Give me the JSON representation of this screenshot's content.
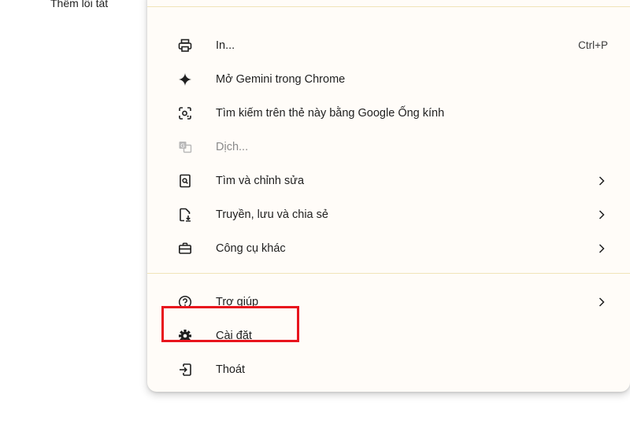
{
  "background": {
    "label": "Thêm lối tắt"
  },
  "menu": {
    "items": [
      {
        "icon": "print-icon",
        "label": "In...",
        "shortcut": "Ctrl+P"
      },
      {
        "icon": "gemini-sparkle-icon",
        "label": "Mở Gemini trong Chrome"
      },
      {
        "icon": "google-lens-icon",
        "label": "Tìm kiếm trên thẻ này bằng Google Ống kính"
      },
      {
        "icon": "translate-icon",
        "label": "Dịch...",
        "disabled": true
      },
      {
        "icon": "find-edit-icon",
        "label": "Tìm và chỉnh sửa",
        "submenu": true
      },
      {
        "icon": "cast-save-share-icon",
        "label": "Truyền, lưu và chia sẻ",
        "submenu": true
      },
      {
        "icon": "toolbox-icon",
        "label": "Công cụ khác",
        "submenu": true
      }
    ],
    "items2": [
      {
        "icon": "help-icon",
        "label": "Trợ giúp",
        "submenu": true
      },
      {
        "icon": "settings-gear-icon",
        "label": "Cài đặt"
      },
      {
        "icon": "exit-icon",
        "label": "Thoát"
      }
    ]
  },
  "highlight": {
    "color": "#e8141d",
    "target": "Cài đặt"
  }
}
